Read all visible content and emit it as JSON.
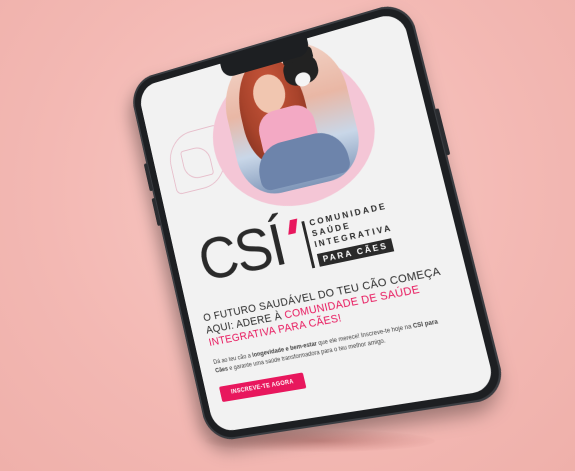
{
  "brand": {
    "logo_letters": "CSÍ",
    "logo_lines": [
      "COMUNIDADE",
      "SAÚDE",
      "INTEGRATIVA"
    ],
    "logo_badge": "PARA CÃES",
    "accent_color": "#e8175d"
  },
  "headline": {
    "part1": "O FUTURO SAUDÁVEL DO TEU CÃO COMEÇA AQUI: ADERE À ",
    "highlight": "COMUNIDADE DE SAÚDE INTEGRATIVA PARA CÃES!"
  },
  "body": {
    "text1": "Dá ao teu cão a ",
    "bold1": "longevidade e bem-estar",
    "text2": " que ele merece! Inscreve-te hoje na ",
    "bold2": "CSI para Cães",
    "text3": " e garante uma saúde transformadora para o teu melhor amigo."
  },
  "cta": {
    "label": "INSCREVE-TE AGORA"
  }
}
